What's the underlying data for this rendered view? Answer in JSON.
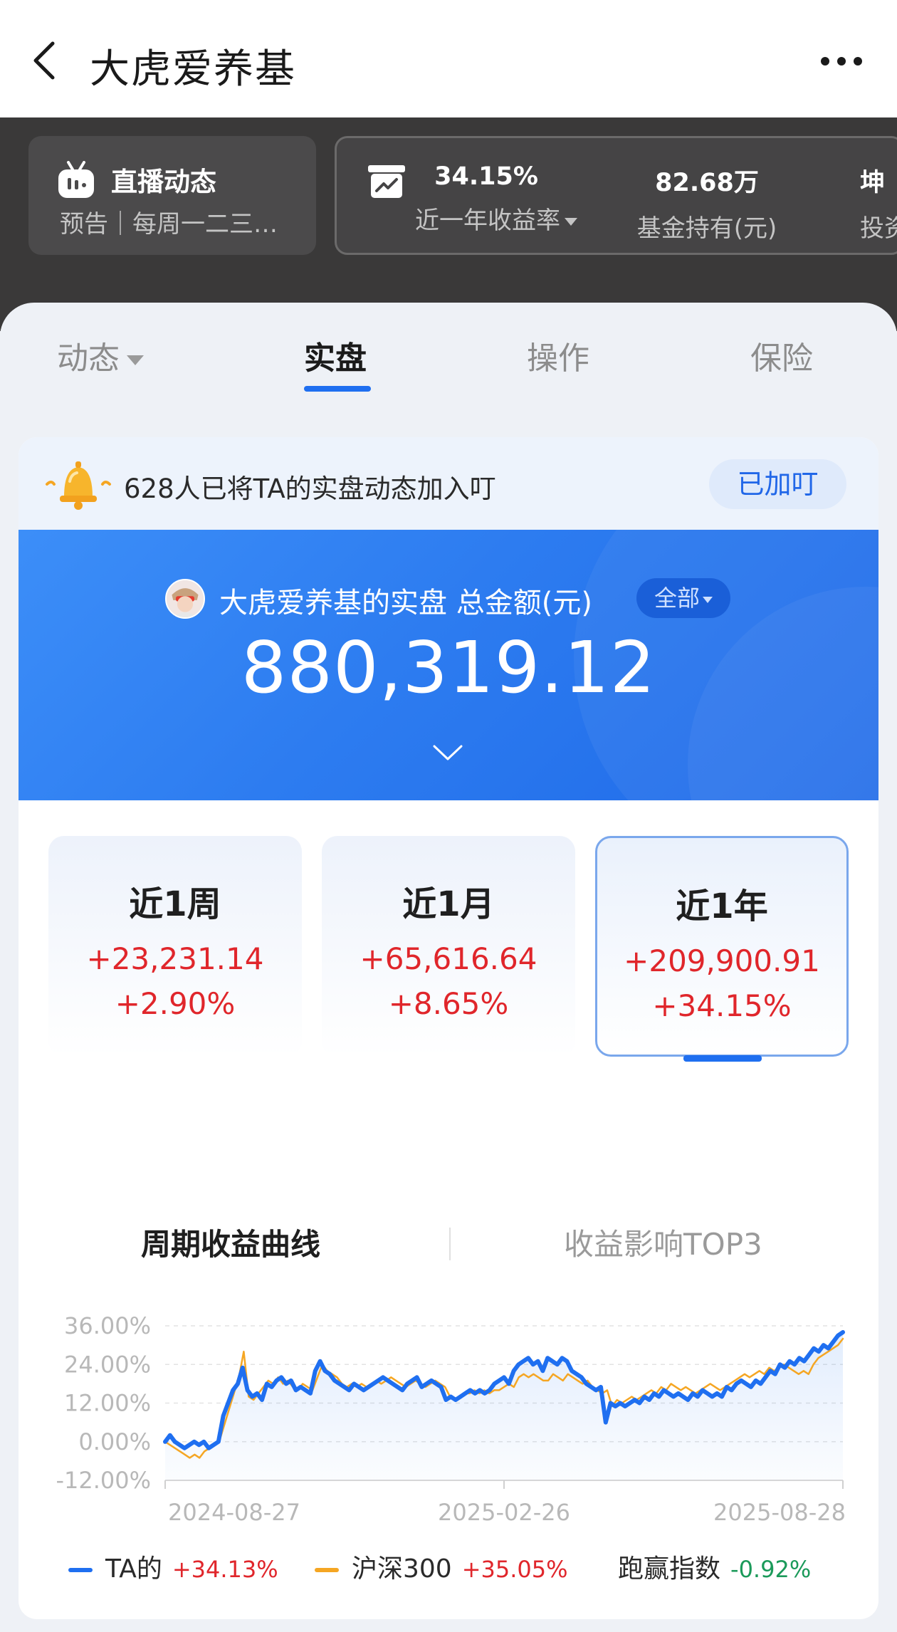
{
  "header": {
    "title": "大虎爱养基"
  },
  "live": {
    "title": "直播动态",
    "subtitle": "预告｜每周一二三…"
  },
  "stats": [
    {
      "value": "34.15%",
      "label": "近一年收益率"
    },
    {
      "value": "82.68万",
      "label": "基金持有(元)"
    },
    {
      "value": "坤",
      "label": "投资"
    }
  ],
  "tabs": [
    "动态",
    "实盘",
    "操作",
    "保险"
  ],
  "notice": {
    "text": "628人已将TA的实盘动态加入叮",
    "button": "已加叮"
  },
  "account": {
    "label": "大虎爱养基的实盘 总金额(元)",
    "filter": "全部",
    "total": "880,319.12"
  },
  "periods": [
    {
      "title": "近1周",
      "amount": "+23,231.14",
      "percent": "+2.90%"
    },
    {
      "title": "近1月",
      "amount": "+65,616.64",
      "percent": "+8.65%"
    },
    {
      "title": "近1年",
      "amount": "+209,900.91",
      "percent": "+34.15%"
    }
  ],
  "subtabs": [
    "周期收益曲线",
    "收益影响TOP3"
  ],
  "chart_data": {
    "type": "line",
    "y_ticks": [
      "36.00%",
      "24.00%",
      "12.00%",
      "0.00%",
      "-12.00%"
    ],
    "ylim": [
      -12,
      36
    ],
    "x_ticks": [
      "2024-08-27",
      "2025-02-26",
      "2025-08-28"
    ],
    "grid": true,
    "series": [
      {
        "name": "TA的",
        "color": "#1f6ff0",
        "values": [
          0,
          2,
          0,
          -1,
          -2,
          -1,
          0,
          -1,
          0,
          -2,
          -1,
          0,
          8,
          12,
          16,
          18,
          23,
          16,
          14,
          15,
          13,
          18,
          17,
          19,
          20,
          18,
          19,
          16,
          17,
          16,
          15,
          22,
          25,
          22,
          21,
          19,
          18,
          17,
          16,
          18,
          17,
          16,
          17,
          18,
          19,
          20,
          19,
          18,
          17,
          16,
          18,
          19,
          20,
          17,
          18,
          19,
          18,
          17,
          13,
          14,
          13,
          14,
          15,
          16,
          15,
          16,
          15,
          16,
          18,
          19,
          20,
          18,
          22,
          24,
          25,
          26,
          24,
          25,
          22,
          26,
          25,
          24,
          26,
          25,
          22,
          21,
          20,
          18,
          17,
          16,
          17,
          6,
          12,
          11,
          12,
          11,
          12,
          13,
          12,
          14,
          13,
          15,
          14,
          16,
          15,
          14,
          15,
          14,
          13,
          15,
          14,
          16,
          15,
          14,
          15,
          14,
          17,
          16,
          18,
          19,
          18,
          17,
          19,
          18,
          20,
          22,
          21,
          24,
          23,
          25,
          24,
          26,
          25,
          27,
          29,
          28,
          30,
          29,
          31,
          33,
          34
        ]
      },
      {
        "name": "沪深300",
        "color": "#f5a623",
        "values": [
          0,
          -1,
          -2,
          -3,
          -4,
          -5,
          -4,
          -5,
          -3,
          -2,
          -1,
          0,
          5,
          10,
          15,
          20,
          28,
          14,
          13,
          15,
          17,
          19,
          18,
          20,
          18,
          19,
          17,
          16,
          18,
          17,
          16,
          20,
          24,
          22,
          21,
          20,
          18,
          17,
          18,
          17,
          18,
          17,
          18,
          19,
          18,
          19,
          20,
          19,
          18,
          17,
          18,
          19,
          18,
          17,
          18,
          19,
          18,
          17,
          14,
          13,
          14,
          15,
          15,
          16,
          15,
          16,
          15,
          16,
          16,
          17,
          18,
          17,
          20,
          21,
          20,
          21,
          20,
          19,
          19,
          21,
          20,
          19,
          21,
          20,
          19,
          18,
          19,
          17,
          16,
          15,
          16,
          11,
          13,
          12,
          13,
          14,
          13,
          14,
          15,
          16,
          15,
          17,
          16,
          18,
          17,
          16,
          17,
          16,
          15,
          16,
          17,
          18,
          17,
          16,
          17,
          18,
          19,
          20,
          21,
          20,
          21,
          22,
          21,
          23,
          22,
          23,
          24,
          23,
          22,
          21,
          22,
          21,
          24,
          26,
          27,
          28,
          29,
          30,
          32
        ]
      }
    ],
    "legend": [
      {
        "name": "TA的",
        "value": "+34.13%",
        "value_color": "#e0262b",
        "color": "#1f6ff0"
      },
      {
        "name": "沪深300",
        "value": "+35.05%",
        "value_color": "#e0262b",
        "color": "#f5a623"
      },
      {
        "name": "跑赢指数",
        "value": "-0.92%",
        "value_color": "#1b9a5a"
      }
    ]
  }
}
